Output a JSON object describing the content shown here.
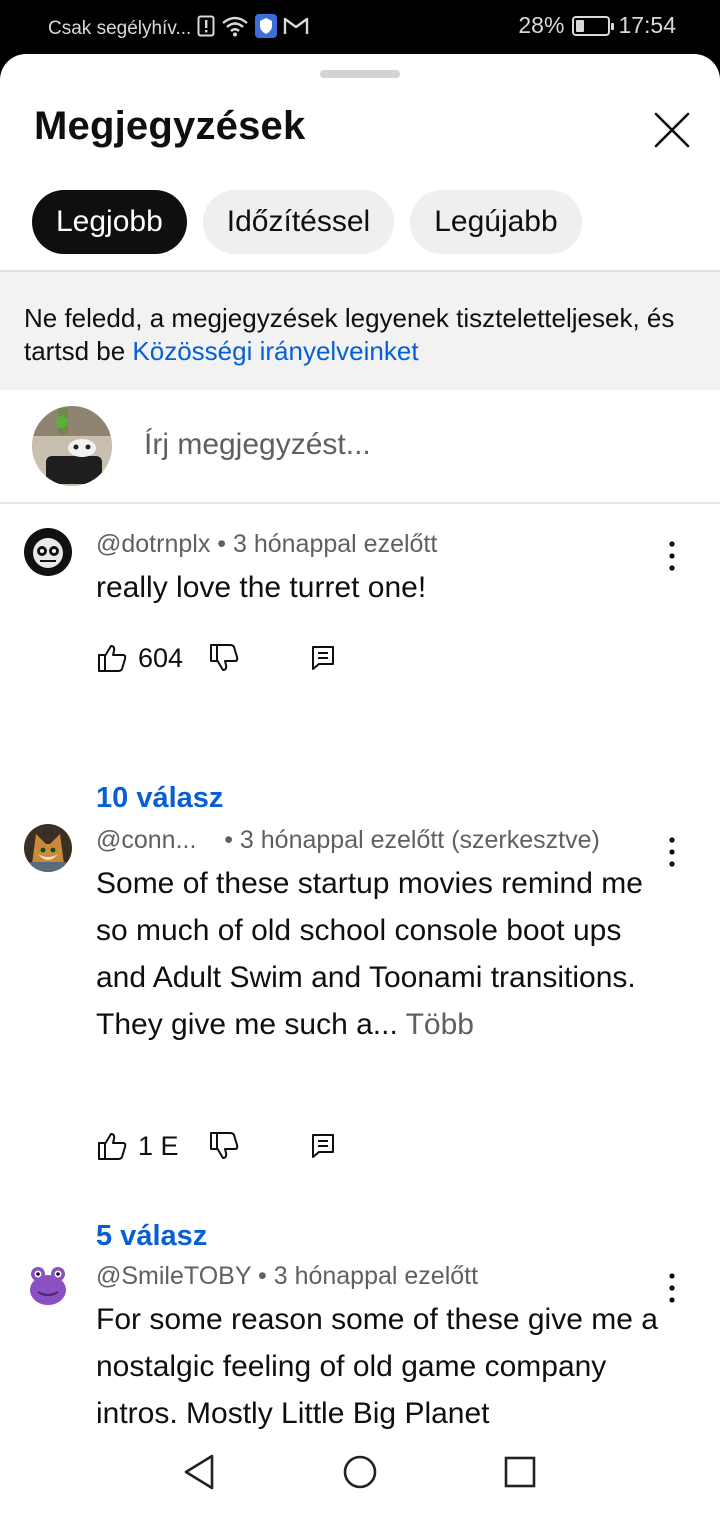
{
  "status_bar": {
    "carrier": "Csak segélyhív...",
    "battery": "28%",
    "battery_level": 0.28,
    "time": "17:54",
    "icons": [
      "sim-alert-icon",
      "wifi-icon",
      "shield-icon",
      "gmail-icon",
      "battery-icon"
    ]
  },
  "sheet": {
    "title": "Megjegyzések",
    "close_icon": "close-icon"
  },
  "sort_chips": [
    {
      "label": "Legjobb",
      "active": true
    },
    {
      "label": "Időzítéssel",
      "active": false
    },
    {
      "label": "Legújabb",
      "active": false
    }
  ],
  "notice": {
    "text": "Ne feledd, a megjegyzések legyenek tiszteletteljesek, és tartsd be ",
    "link": "Közösségi irányelveinket"
  },
  "composer": {
    "placeholder": "Írj megjegyzést..."
  },
  "comments": [
    {
      "handle": "@dotrnplx",
      "time": "3 hónappal ezelőtt",
      "edited": "",
      "text": "really love the turret one!",
      "more": "",
      "likes": "604",
      "replies": "10 válasz"
    },
    {
      "handle": "@conn...",
      "time": "3 hónappal ezelőtt (szerkesztve)",
      "text": "Some of these startup movies remind me so much of old school console boot ups and Adult Swim and Toonami transitions. They give me such a... ",
      "more": "Több",
      "likes": "1 E",
      "replies": "5 válasz"
    },
    {
      "handle": "@SmileTOBY",
      "time": "3 hónappal ezelőtt",
      "text": "For some reason some of these give me a nostalgic feeling of old game company intros. Mostly Little Big Planet",
      "more": "",
      "likes": "",
      "replies": ""
    }
  ],
  "nav_bar": {
    "icons": [
      "back-icon",
      "home-icon",
      "recents-icon"
    ]
  }
}
